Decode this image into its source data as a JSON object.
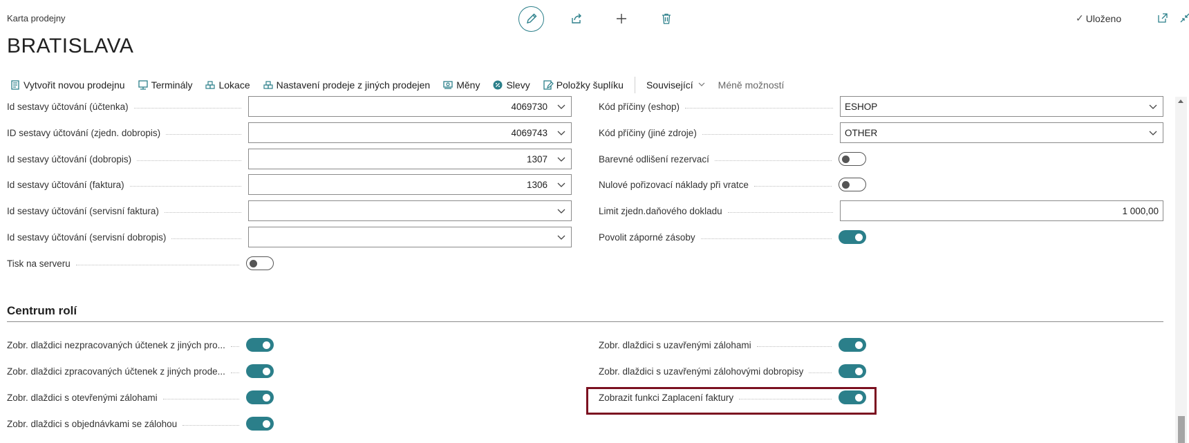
{
  "page": {
    "caption": "Karta prodejny",
    "title": "BRATISLAVA",
    "saved_status": "Uloženo"
  },
  "header_icons": [
    "edit-icon",
    "share-icon",
    "add-icon",
    "delete-icon"
  ],
  "corner_icons": [
    "open-new-window-icon",
    "collapse-icon"
  ],
  "ribbon": {
    "new_store": "Vytvořit novou prodejnu",
    "terminals": "Terminály",
    "locations": "Lokace",
    "store_settings": "Nastavení prodeje z jiných prodejen",
    "currencies": "Měny",
    "discounts": "Slevy",
    "drawer_items": "Položky šuplíku",
    "related": "Související",
    "fewer_options": "Méně možností"
  },
  "left_fields": [
    {
      "label": "Id sestavy účtování (účtenka)",
      "value": "4069730"
    },
    {
      "label": "ID sestavy účtování (zjedn. dobropis)",
      "value": "4069743"
    },
    {
      "label": "Id sestavy účtování (dobropis)",
      "value": "1307"
    },
    {
      "label": "Id sestavy účtování (faktura)",
      "value": "1306"
    },
    {
      "label": "Id sestavy účtování (servisní faktura)",
      "value": ""
    },
    {
      "label": "Id sestavy účtování (servisní dobropis)",
      "value": ""
    }
  ],
  "print_on_server": {
    "label": "Tisk na serveru",
    "enabled": false
  },
  "right_fields": {
    "reason_eshop": {
      "label": "Kód příčiny (eshop)",
      "value": "ESHOP"
    },
    "reason_other": {
      "label": "Kód příčiny (jiné zdroje)",
      "value": "OTHER"
    },
    "color_reservation": {
      "label": "Barevné odlišení rezervací",
      "enabled": false
    },
    "zero_cost_return": {
      "label": "Nulové pořizovací náklady při vratce",
      "enabled": false
    },
    "tax_doc_limit": {
      "label": "Limit zjedn.daňového dokladu",
      "value": "1 000,00"
    },
    "negative_stock": {
      "label": "Povolit záporné zásoby",
      "enabled": true
    }
  },
  "role_center": {
    "title": "Centrum rolí",
    "left": [
      {
        "label": "Zobr. dlaždici nezpracovaných účtenek z jiných pro...",
        "enabled": true
      },
      {
        "label": "Zobr. dlaždici zpracovaných účtenek z jiných prode...",
        "enabled": true
      },
      {
        "label": "Zobr. dlaždici s otevřenými zálohami",
        "enabled": true
      },
      {
        "label": "Zobr. dlaždici s objednávkami se zálohou",
        "enabled": true
      }
    ],
    "right": [
      {
        "label": "Zobr. dlaždici s uzavřenými zálohami",
        "enabled": true
      },
      {
        "label": "Zobr. dlaždici s uzavřenými zálohovými dobropisy",
        "enabled": true
      },
      {
        "label": "Zobrazit funkci Zaplacení faktury",
        "enabled": true,
        "highlighted": true
      }
    ]
  },
  "colors": {
    "accent": "#2b7f8a",
    "highlight": "#7b1020"
  }
}
